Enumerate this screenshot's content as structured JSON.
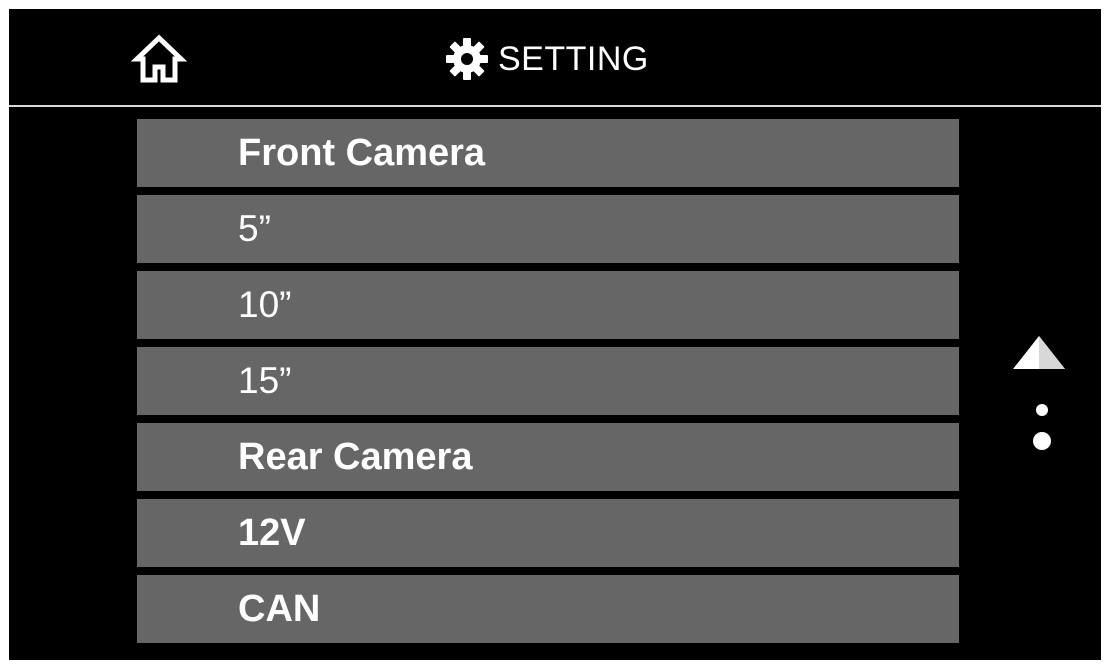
{
  "header": {
    "title": "SETTING",
    "home_icon": "home-icon",
    "title_icon": "gear-icon"
  },
  "colors": {
    "background": "#000000",
    "row_background": "#666666",
    "text": "#ffffff",
    "divider": "#d9d9d9"
  },
  "list": {
    "items": [
      {
        "label": "Front Camera",
        "style": "bold"
      },
      {
        "label": "5”",
        "style": "regular"
      },
      {
        "label": "10”",
        "style": "regular"
      },
      {
        "label": "15”",
        "style": "regular"
      },
      {
        "label": "Rear Camera",
        "style": "bold"
      },
      {
        "label": "12V",
        "style": "bold"
      },
      {
        "label": "CAN",
        "style": "bold"
      }
    ]
  },
  "scroll": {
    "up_icon": "triangle-up-icon",
    "page_indicator": {
      "page_count": 2,
      "current_page": 2
    }
  }
}
